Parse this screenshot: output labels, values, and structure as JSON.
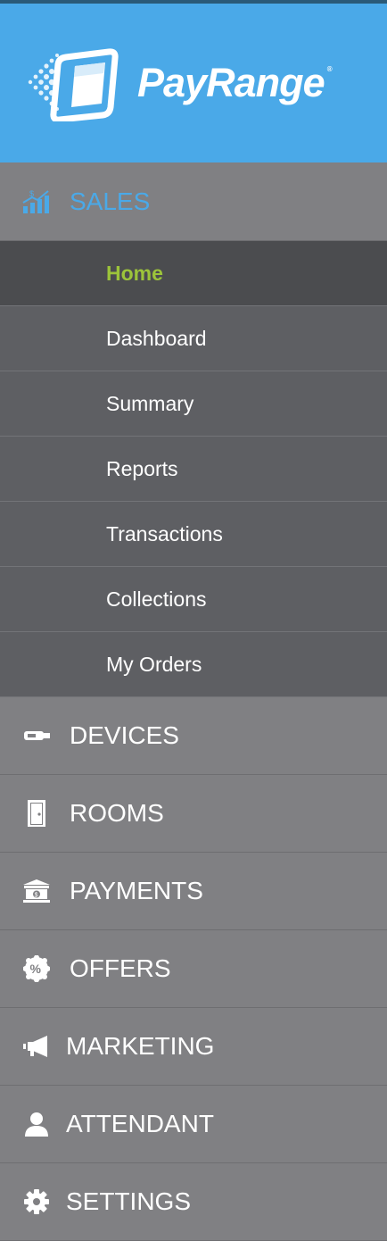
{
  "brand": {
    "name": "PayRange",
    "trademark": "®"
  },
  "sections": {
    "sales": {
      "label": "SALES",
      "icon": "chart-dollar-icon",
      "active": true
    }
  },
  "sales_items": [
    {
      "label": "Home",
      "active": true
    },
    {
      "label": "Dashboard"
    },
    {
      "label": "Summary"
    },
    {
      "label": "Reports"
    },
    {
      "label": "Transactions"
    },
    {
      "label": "Collections"
    },
    {
      "label": "My Orders"
    }
  ],
  "nav": [
    {
      "label": "DEVICES",
      "icon": "device-icon"
    },
    {
      "label": "ROOMS",
      "icon": "door-icon"
    },
    {
      "label": "PAYMENTS",
      "icon": "bank-icon"
    },
    {
      "label": "OFFERS",
      "icon": "percent-badge-icon"
    },
    {
      "label": "MARKETING",
      "icon": "megaphone-icon"
    },
    {
      "label": "ATTENDANT",
      "icon": "user-icon"
    },
    {
      "label": "SETTINGS",
      "icon": "gear-icon"
    }
  ],
  "colors": {
    "header": "#4aa9e8",
    "sidebar": "#808083",
    "submenu": "#5e5f63",
    "submenu_active": "#4b4c4f",
    "active_text": "#9cc43a",
    "sales_accent": "#4aa9e8"
  }
}
